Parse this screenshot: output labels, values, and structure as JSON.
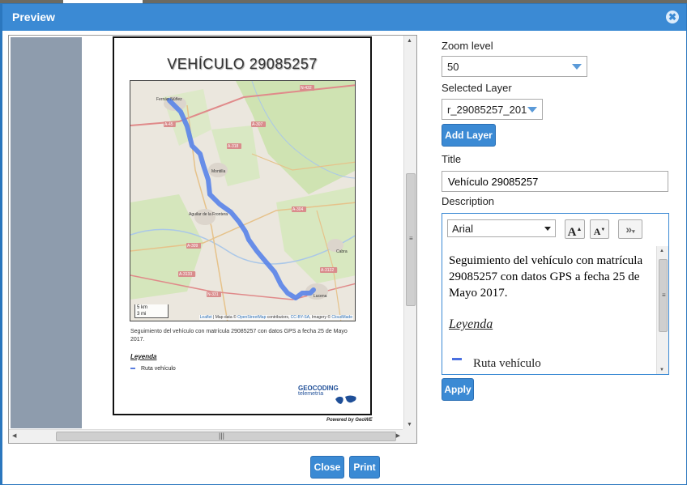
{
  "dialog": {
    "title": "Preview",
    "close_icon": "close-icon",
    "close_glyph": "✖"
  },
  "document": {
    "title": "VEHÍCULO 29085257",
    "description": "Seguimiento del vehículo con matrícula 29085257 con datos GPS a fecha 25 de Mayo 2017.",
    "legend_title": "Leyenda",
    "legend_item": "Ruta vehículo",
    "powered_by": "Powered by GeoWE",
    "logo_text": "GEOCODING",
    "logo_sub": "telemetría"
  },
  "map": {
    "route_color": "#5b86e8",
    "place_labels": [
      "Fernán Núñez",
      "Montilla",
      "Aguilar de la Frontera",
      "Cabra",
      "Lucena"
    ],
    "road_labels": [
      "N-432",
      "A-45",
      "A-307",
      "A-318",
      "A-304",
      "A-309",
      "A-3133",
      "N-331",
      "A-3132"
    ],
    "scale_top": "5 km",
    "scale_bottom": "3 mi",
    "attribution_leaflet": "Leaflet",
    "attribution_1": " | Map data © ",
    "attribution_osm": "OpenStreetMap",
    "attribution_2": " contributors, ",
    "attribution_cc": "CC-BY-SA",
    "attribution_3": ", Imagery © ",
    "attribution_cm": "CloudMade"
  },
  "panel": {
    "zoom_label": "Zoom level",
    "zoom_value": "50",
    "layer_label": "Selected Layer",
    "layer_value": "r_29085257_201",
    "add_layer": "Add Layer",
    "title_label": "Title",
    "title_value": "Vehículo 29085257",
    "description_label": "Description",
    "font_value": "Arial",
    "grow_font": "A",
    "shrink_font": "A",
    "more_tools": "»",
    "editor_text": "Seguimiento del vehículo con matrícula 29085257 con datos GPS a fecha 25 de Mayo 2017.",
    "editor_legend": "Leyenda",
    "editor_legend_item": "Ruta vehículo",
    "apply": "Apply"
  },
  "footer": {
    "close": "Close",
    "print": "Print"
  },
  "colors": {
    "accent": "#3b8ad4",
    "titlebar": "#3b8ad4",
    "route": "#5b86e8"
  }
}
